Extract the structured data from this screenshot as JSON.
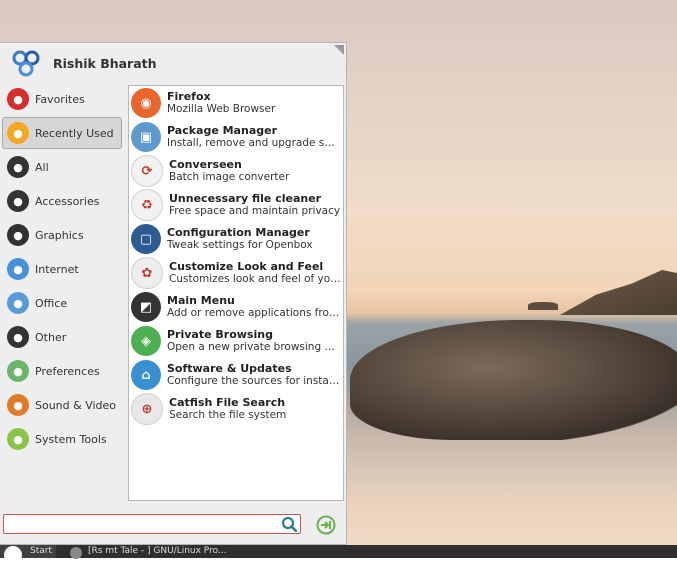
{
  "user": {
    "name": "Rishik Bharath"
  },
  "categories": [
    {
      "label": "Favorites",
      "icon": "bookmark-icon",
      "color": "#d32f2f"
    },
    {
      "label": "Recently Used",
      "icon": "recent-icon",
      "color": "#f5a623",
      "selected": true
    },
    {
      "label": "All",
      "icon": "all-apps-icon",
      "color": "#333333"
    },
    {
      "label": "Accessories",
      "icon": "accessories-icon",
      "color": "#333333"
    },
    {
      "label": "Graphics",
      "icon": "graphics-icon",
      "color": "#333333"
    },
    {
      "label": "Internet",
      "icon": "cloud-icon",
      "color": "#4a90d9"
    },
    {
      "label": "Office",
      "icon": "office-icon",
      "color": "#5b9bd5"
    },
    {
      "label": "Other",
      "icon": "other-icon",
      "color": "#333333"
    },
    {
      "label": "Preferences",
      "icon": "toggle-icon",
      "color": "#6bb56b"
    },
    {
      "label": "Sound & Video",
      "icon": "speaker-icon",
      "color": "#e07b2a"
    },
    {
      "label": "System Tools",
      "icon": "info-icon",
      "color": "#8bc34a"
    }
  ],
  "apps": [
    {
      "name": "Firefox",
      "desc": "Mozilla Web Browser",
      "icon": "firefox-icon",
      "color": "#e8652b",
      "glyph": "◉"
    },
    {
      "name": "Package Manager",
      "desc": "Install, remove and upgrade soft...",
      "icon": "package-icon",
      "color": "#5e9ad0",
      "glyph": "▣"
    },
    {
      "name": "Converseen",
      "desc": "Batch image converter",
      "icon": "converseen-icon",
      "color": "#f2f2f2",
      "glyph": "⟳"
    },
    {
      "name": "Unnecessary file cleaner",
      "desc": "Free space and maintain privacy",
      "icon": "cleaner-icon",
      "color": "#f2f2f2",
      "glyph": "♻"
    },
    {
      "name": "Configuration Manager",
      "desc": "Tweak settings for Openbox",
      "icon": "config-manager-icon",
      "color": "#2e5b94",
      "glyph": "▢"
    },
    {
      "name": "Customize Look and Feel",
      "desc": "Customizes look and feel of your ...",
      "icon": "palette-icon",
      "color": "#eeeeee",
      "glyph": "✿"
    },
    {
      "name": "Main Menu",
      "desc": "Add or remove applications from...",
      "icon": "main-menu-icon",
      "color": "#333333",
      "glyph": "◩"
    },
    {
      "name": "Private Browsing",
      "desc": "Open a new private browsing win...",
      "icon": "private-browsing-icon",
      "color": "#4caf50",
      "glyph": "◈"
    },
    {
      "name": "Software & Updates",
      "desc": "Configure the sources for installa...",
      "icon": "software-updates-icon",
      "color": "#3a8fd0",
      "glyph": "⌂"
    },
    {
      "name": "Catfish File Search",
      "desc": "Search the file system",
      "icon": "catfish-search-icon",
      "color": "#e8e8e8",
      "glyph": "⊕"
    }
  ],
  "search": {
    "value": "",
    "placeholder": ""
  },
  "taskbar": {
    "start_label": "Start",
    "task_label": "[Rs mt Tale - ] GNU/Linux Pro..."
  },
  "colors": {
    "search_border": "#c65a55",
    "accent_green": "#6ab04c"
  }
}
